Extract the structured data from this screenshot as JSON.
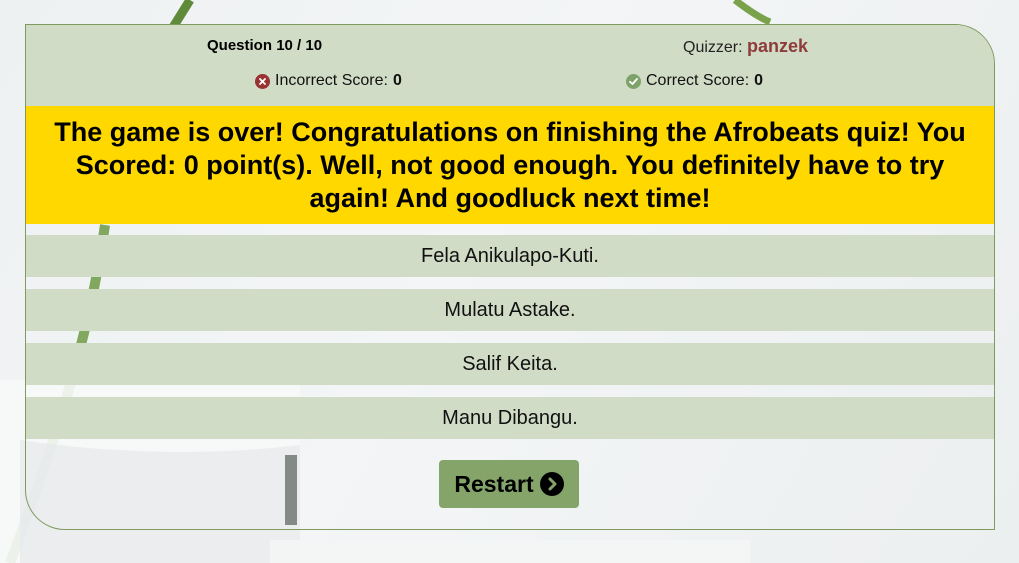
{
  "header": {
    "question_label": "Question",
    "question_current": "10",
    "question_total": "10",
    "quizzer_label": "Quizzer:",
    "quizzer_name": "panzek",
    "incorrect_label": "Incorrect Score:",
    "incorrect_value": "0",
    "correct_label": "Correct Score:",
    "correct_value": "0"
  },
  "result": {
    "message": "The game is over! Congratulations on finishing the Afrobeats quiz! You Scored: 0 point(s). Well, not good enough. You definitely have to try again! And goodluck next time!"
  },
  "answers": [
    "Fela Anikulapo-Kuti.",
    "Mulatu Astake.",
    "Salif Keita.",
    "Manu Dibangu."
  ],
  "controls": {
    "restart_label": "Restart"
  },
  "icons": {
    "incorrect": "x-circle-icon",
    "correct": "check-circle-icon",
    "restart": "chevron-right-circle-icon"
  },
  "colors": {
    "panel_bg": "#d1dcc6",
    "banner_bg": "#ffd800",
    "quizzer_name": "#8e3b3b",
    "incorrect_icon": "#993333",
    "correct_icon": "#7ea36a",
    "button_bg": "#85a46a",
    "border": "#7f9a5f"
  }
}
